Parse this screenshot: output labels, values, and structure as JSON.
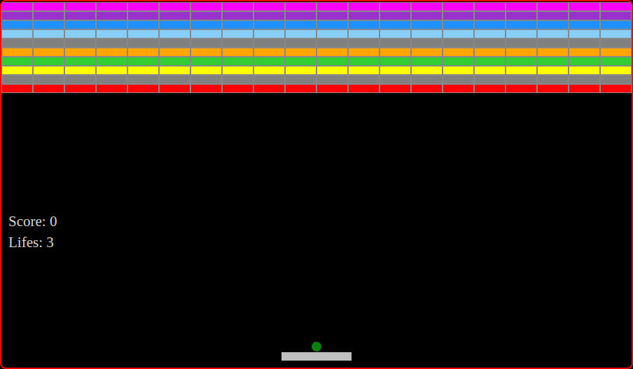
{
  "bricks": {
    "columns": 20,
    "rows": [
      {
        "color": "#ff00ff"
      },
      {
        "color": "#9932cc"
      },
      {
        "color": "#1e90ff"
      },
      {
        "color": "#87cefa"
      },
      {
        "color": "#808080"
      },
      {
        "color": "#ffa500"
      },
      {
        "color": "#32cd32"
      },
      {
        "color": "#ffff00"
      },
      {
        "color": "#808080"
      },
      {
        "color": "#ff0000"
      }
    ]
  },
  "hud": {
    "score": "Score: 0",
    "lives": "Lifes: 3"
  },
  "ball": {
    "color": "#0a7f0a"
  },
  "paddle": {
    "color": "#c0c0c0"
  }
}
